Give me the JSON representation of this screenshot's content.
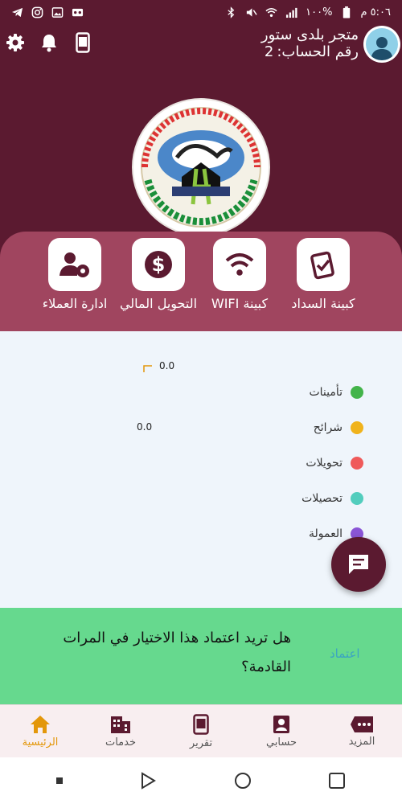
{
  "status_bar": {
    "time": "٥:٠٦ م",
    "battery": "١٠٠%",
    "icons_left": [
      "telegram-icon",
      "instagram-icon",
      "gallery-icon",
      "voicemail-icon"
    ],
    "icons_right": [
      "bluetooth-icon",
      "mute-icon",
      "wifi-icon",
      "signal-icon",
      "battery-icon"
    ]
  },
  "header": {
    "store_name": "متجر بلدى ستور",
    "account_label": "رقم الحساب:",
    "account_number": "2",
    "tools": [
      "settings-icon",
      "bell-icon",
      "device-icon"
    ],
    "logo_text": "الهيثمي"
  },
  "services": [
    {
      "label": "كبينة السداد",
      "icon": "payment-check-icon"
    },
    {
      "label": "كبينة WIFI",
      "icon": "wifi-icon"
    },
    {
      "label": "التحويل المالي",
      "icon": "dollar-icon"
    },
    {
      "label": "ادارة العملاء",
      "icon": "user-gear-icon"
    }
  ],
  "chart_data": {
    "type": "pie",
    "values": [
      0.0,
      0.0
    ],
    "value_labels": [
      "0.0",
      "0.0"
    ],
    "legend": [
      {
        "name": "تأمينات",
        "color": "#43b44a"
      },
      {
        "name": "شرائح",
        "color": "#f0b31c"
      },
      {
        "name": "تحويلات",
        "color": "#ef5a5a"
      },
      {
        "name": "تحصيلات",
        "color": "#52cdbd"
      },
      {
        "name": "العمولة",
        "color": "#8a55d6"
      }
    ]
  },
  "banner": {
    "question": "هل تريد اعتماد هذا الاختيار في المرات القادمة؟",
    "confirm_label": "اعتماد"
  },
  "bottom_nav": [
    {
      "label": "الرئيسية",
      "icon": "home-icon",
      "active": true
    },
    {
      "label": "خدمات",
      "icon": "buildings-icon",
      "active": false
    },
    {
      "label": "تقرير",
      "icon": "report-icon",
      "active": false
    },
    {
      "label": "حسابي",
      "icon": "profile-icon",
      "active": false
    },
    {
      "label": "المزيد",
      "icon": "more-icon",
      "active": false
    }
  ],
  "colors": {
    "primary": "#5b1a30",
    "services_bg": "#a0455f",
    "chart_bg": "#eff5fb",
    "banner_bg": "#66d98e",
    "active": "#e3970a",
    "link": "#3ba4c2"
  }
}
